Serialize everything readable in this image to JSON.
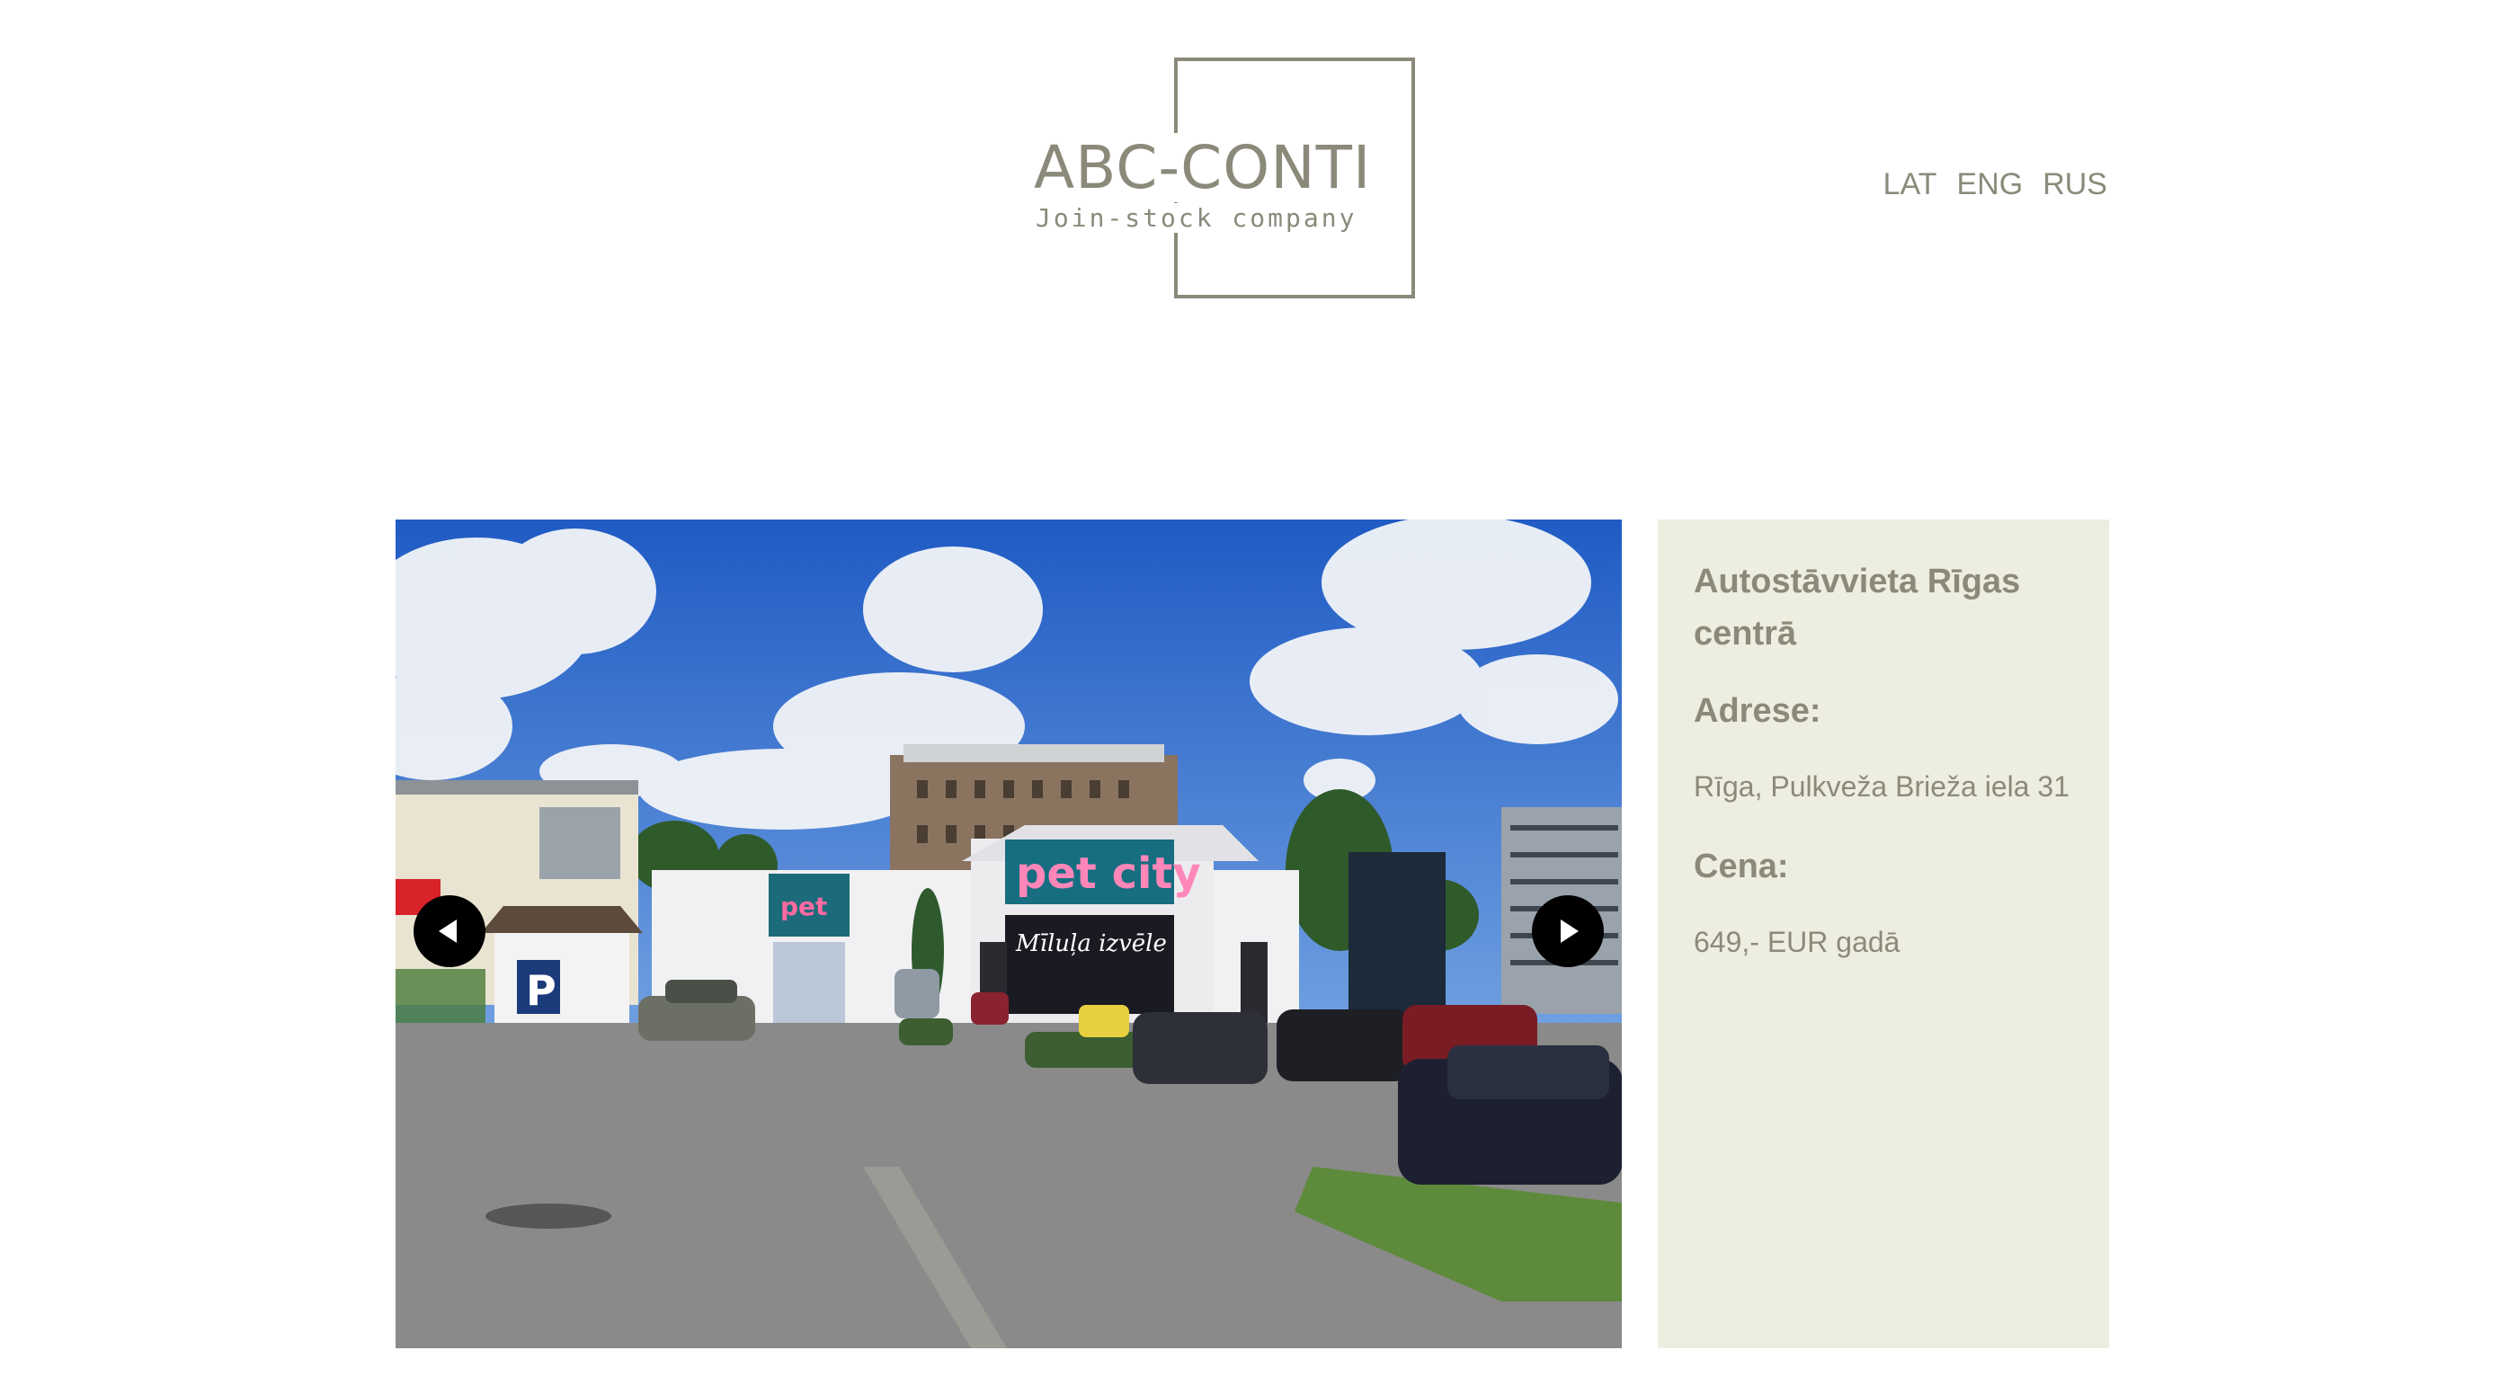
{
  "logo": {
    "title": "ABC-CONTI",
    "subtitle": "Join-stock company"
  },
  "languages": [
    "LAT",
    "ENG",
    "RUS"
  ],
  "gallery": {
    "image_alt": "Parking lot with Pet City store building"
  },
  "listing": {
    "title": "Autostāvvieta Rīgas centrā",
    "address_label": "Adrese:",
    "address": "Rīga, Pulkveža Brieža iela 31",
    "price_label": "Cena:",
    "price": "649,- EUR gadā"
  },
  "colors": {
    "accent_text": "#8b8a7a",
    "panel_bg": "#edeee0"
  }
}
